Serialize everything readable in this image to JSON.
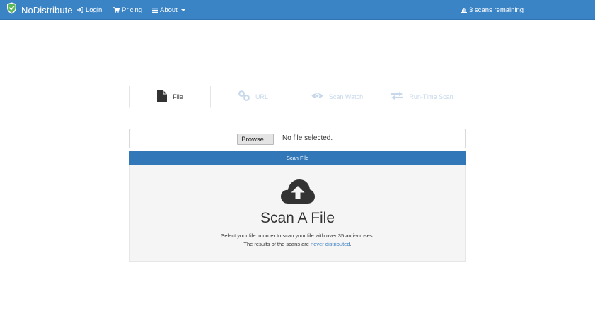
{
  "navbar": {
    "brand": "NoDistribute",
    "login": "Login",
    "pricing": "Pricing",
    "about": "About",
    "scans_remaining": "3 scans remaining"
  },
  "tabs": [
    {
      "label": "File",
      "icon": "file-icon",
      "active": true
    },
    {
      "label": "URL",
      "icon": "link-icon",
      "active": false
    },
    {
      "label": "Scan Watch",
      "icon": "eye-icon",
      "active": false
    },
    {
      "label": "Run-Time Scan",
      "icon": "exchange-icon",
      "active": false
    }
  ],
  "file_input": {
    "button_label": "Browse...",
    "status": "No file selected."
  },
  "scan_button": "Scan File",
  "drop_panel": {
    "icon": "cloud-upload-icon",
    "title": "Scan A File",
    "line1": "Select your file in order to scan your file with over 35 anti-viruses.",
    "line2_prefix": "The results of the scans are ",
    "line2_link": "never distributed",
    "line2_suffix": "."
  },
  "colors": {
    "navbar": "#3a84c6",
    "primary_button": "#3278b8",
    "inactive_tab": "#c7d8ea",
    "shield": "#5cb85c"
  }
}
